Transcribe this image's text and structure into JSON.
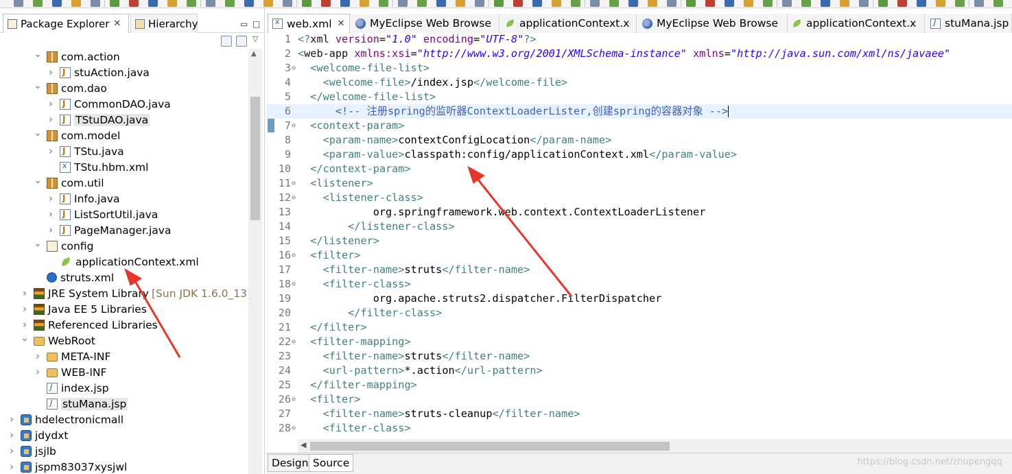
{
  "left_panel": {
    "tabs": [
      {
        "label": "Package Explorer",
        "close": "✕"
      },
      {
        "label": "Hierarchy"
      }
    ],
    "tree": [
      {
        "label": "com.action",
        "icon": "package-icon",
        "indent": 1,
        "expanded": true
      },
      {
        "label": "stuAction.java",
        "icon": "java-file-icon",
        "indent": 2,
        "expanded": false
      },
      {
        "label": "com.dao",
        "icon": "package-icon",
        "indent": 1,
        "expanded": true
      },
      {
        "label": "CommonDAO.java",
        "icon": "java-file-icon",
        "indent": 2,
        "expanded": false
      },
      {
        "label": "TStuDAO.java",
        "icon": "java-file-icon",
        "indent": 2,
        "expanded": false,
        "selected": true
      },
      {
        "label": "com.model",
        "icon": "package-icon",
        "indent": 1,
        "expanded": true
      },
      {
        "label": "TStu.java",
        "icon": "java-file-icon",
        "indent": 2,
        "expanded": false
      },
      {
        "label": "TStu.hbm.xml",
        "icon": "xml-file-icon",
        "indent": 2,
        "leaf": true
      },
      {
        "label": "com.util",
        "icon": "package-icon",
        "indent": 1,
        "expanded": true
      },
      {
        "label": "Info.java",
        "icon": "java-file-icon",
        "indent": 2,
        "expanded": false
      },
      {
        "label": "ListSortUtil.java",
        "icon": "java-file-icon",
        "indent": 2,
        "expanded": false
      },
      {
        "label": "PageManager.java",
        "icon": "java-file-icon",
        "indent": 2,
        "expanded": false
      },
      {
        "label": "config",
        "icon": "source-folder-icon",
        "indent": 1,
        "expanded": true
      },
      {
        "label": "applicationContext.xml",
        "icon": "spring-leaf-icon",
        "indent": 2,
        "leaf": true
      },
      {
        "label": "struts.xml",
        "icon": "gear-icon",
        "indent": 1,
        "leaf": true
      },
      {
        "label": "JRE System Library",
        "extra": "[Sun JDK 1.6.0_13]",
        "icon": "library-icon",
        "indent": 0,
        "expanded": false
      },
      {
        "label": "Java EE 5 Libraries",
        "icon": "library-icon",
        "indent": 0,
        "expanded": false
      },
      {
        "label": "Referenced Libraries",
        "icon": "library-icon",
        "indent": 0,
        "expanded": false
      },
      {
        "label": "WebRoot",
        "icon": "webroot-folder-icon",
        "indent": 0,
        "expanded": true
      },
      {
        "label": "META-INF",
        "icon": "folder-icon",
        "indent": 1,
        "expanded": false
      },
      {
        "label": "WEB-INF",
        "icon": "folder-icon",
        "indent": 1,
        "expanded": false
      },
      {
        "label": "index.jsp",
        "icon": "jsp-file-icon",
        "indent": 1,
        "leaf": true
      },
      {
        "label": "stuMana.jsp",
        "icon": "jsp-file-icon",
        "indent": 1,
        "leaf": true,
        "selected": true
      },
      {
        "label": "hdelectronicmall",
        "icon": "project-icon",
        "indent": -1,
        "expanded": false
      },
      {
        "label": "jdydxt",
        "icon": "project-icon",
        "indent": -1,
        "expanded": false
      },
      {
        "label": "jsjlb",
        "icon": "project-icon",
        "indent": -1,
        "expanded": false
      },
      {
        "label": "jspm83037xysjwl",
        "icon": "project-icon",
        "indent": -1,
        "expanded": false
      }
    ]
  },
  "editor": {
    "tabs": [
      {
        "label": "web.xml",
        "icon": "xml",
        "active": true,
        "close": "✕"
      },
      {
        "label": "MyEclipse Web Browse",
        "icon": "globe"
      },
      {
        "label": "applicationContext.x",
        "icon": "leaf"
      },
      {
        "label": "MyEclipse Web Browse",
        "icon": "globe"
      },
      {
        "label": "applicationContext.x",
        "icon": "leaf"
      },
      {
        "label": "stuMana.jsp",
        "icon": "jsp"
      }
    ],
    "lines": [
      {
        "n": "1",
        "fold": false,
        "hl": false,
        "parts": [
          [
            "pi",
            "<?"
          ],
          [
            "name",
            "xml "
          ],
          [
            "attr",
            "version"
          ],
          [
            "text",
            "="
          ],
          [
            "val",
            "\"1.0\""
          ],
          [
            "text",
            " "
          ],
          [
            "attr",
            "encoding"
          ],
          [
            "text",
            "="
          ],
          [
            "val",
            "\"UTF-8\""
          ],
          [
            "pi",
            "?>"
          ]
        ]
      },
      {
        "n": "2",
        "fold": false,
        "hl": false,
        "parts": [
          [
            "tag",
            "<"
          ],
          [
            "name",
            "web-app "
          ],
          [
            "attr",
            "xmlns:xsi"
          ],
          [
            "text",
            "="
          ],
          [
            "val",
            "\"http://www.w3.org/2001/XMLSchema-instance\""
          ],
          [
            "text",
            " "
          ],
          [
            "attr",
            "xmlns"
          ],
          [
            "text",
            "="
          ],
          [
            "val",
            "\"http://java.sun.com/xml/ns/javaee\""
          ]
        ]
      },
      {
        "n": "3",
        "fold": true,
        "hl": false,
        "parts": [
          [
            "text",
            "  "
          ],
          [
            "tag",
            "<welcome-file-list>"
          ]
        ]
      },
      {
        "n": "4",
        "fold": false,
        "hl": false,
        "parts": [
          [
            "text",
            "    "
          ],
          [
            "tag",
            "<welcome-file>"
          ],
          [
            "text",
            "/index.jsp"
          ],
          [
            "tag",
            "</welcome-file>"
          ]
        ]
      },
      {
        "n": "5",
        "fold": false,
        "hl": false,
        "parts": [
          [
            "text",
            "  "
          ],
          [
            "tag",
            "</welcome-file-list>"
          ]
        ]
      },
      {
        "n": "6",
        "fold": false,
        "hl": true,
        "caret": true,
        "parts": [
          [
            "text",
            "      "
          ],
          [
            "com",
            "<!-- 注册spring的监听器ContextLoaderLister,创建spring的容器对象 -->"
          ]
        ]
      },
      {
        "n": "7",
        "fold": true,
        "hl": false,
        "parts": [
          [
            "text",
            "  "
          ],
          [
            "tag",
            "<context-param>"
          ]
        ]
      },
      {
        "n": "8",
        "fold": false,
        "hl": false,
        "parts": [
          [
            "text",
            "    "
          ],
          [
            "tag",
            "<param-name>"
          ],
          [
            "text",
            "contextConfigLocation"
          ],
          [
            "tag",
            "</param-name>"
          ]
        ]
      },
      {
        "n": "9",
        "fold": false,
        "hl": false,
        "parts": [
          [
            "text",
            "    "
          ],
          [
            "tag",
            "<param-value>"
          ],
          [
            "text",
            "classpath:config/applicationContext.xml"
          ],
          [
            "tag",
            "</param-value>"
          ]
        ]
      },
      {
        "n": "10",
        "fold": false,
        "hl": false,
        "parts": [
          [
            "text",
            "  "
          ],
          [
            "tag",
            "</context-param>"
          ]
        ]
      },
      {
        "n": "11",
        "fold": true,
        "hl": false,
        "parts": [
          [
            "text",
            "  "
          ],
          [
            "tag",
            "<listener>"
          ]
        ]
      },
      {
        "n": "12",
        "fold": true,
        "hl": false,
        "parts": [
          [
            "text",
            "    "
          ],
          [
            "tag",
            "<listener-class>"
          ]
        ]
      },
      {
        "n": "13",
        "fold": false,
        "hl": false,
        "parts": [
          [
            "text",
            "            org.springframework.web.context.ContextLoaderListener"
          ]
        ]
      },
      {
        "n": "14",
        "fold": false,
        "hl": false,
        "parts": [
          [
            "text",
            "        "
          ],
          [
            "tag",
            "</listener-class>"
          ]
        ]
      },
      {
        "n": "15",
        "fold": false,
        "hl": false,
        "parts": [
          [
            "text",
            "  "
          ],
          [
            "tag",
            "</listener>"
          ]
        ]
      },
      {
        "n": "16",
        "fold": true,
        "hl": false,
        "parts": [
          [
            "text",
            "  "
          ],
          [
            "tag",
            "<filter>"
          ]
        ]
      },
      {
        "n": "17",
        "fold": false,
        "hl": false,
        "parts": [
          [
            "text",
            "    "
          ],
          [
            "tag",
            "<filter-name>"
          ],
          [
            "text",
            "struts"
          ],
          [
            "tag",
            "</filter-name>"
          ]
        ]
      },
      {
        "n": "18",
        "fold": true,
        "hl": false,
        "parts": [
          [
            "text",
            "    "
          ],
          [
            "tag",
            "<filter-class>"
          ]
        ]
      },
      {
        "n": "19",
        "fold": false,
        "hl": false,
        "parts": [
          [
            "text",
            "            org.apache.struts2.dispatcher.FilterDispatcher"
          ]
        ]
      },
      {
        "n": "20",
        "fold": false,
        "hl": false,
        "parts": [
          [
            "text",
            "        "
          ],
          [
            "tag",
            "</filter-class>"
          ]
        ]
      },
      {
        "n": "21",
        "fold": false,
        "hl": false,
        "parts": [
          [
            "text",
            "  "
          ],
          [
            "tag",
            "</filter>"
          ]
        ]
      },
      {
        "n": "22",
        "fold": true,
        "hl": false,
        "parts": [
          [
            "text",
            "  "
          ],
          [
            "tag",
            "<filter-mapping>"
          ]
        ]
      },
      {
        "n": "23",
        "fold": false,
        "hl": false,
        "parts": [
          [
            "text",
            "    "
          ],
          [
            "tag",
            "<filter-name>"
          ],
          [
            "text",
            "struts"
          ],
          [
            "tag",
            "</filter-name>"
          ]
        ]
      },
      {
        "n": "24",
        "fold": false,
        "hl": false,
        "parts": [
          [
            "text",
            "    "
          ],
          [
            "tag",
            "<url-pattern>"
          ],
          [
            "text",
            "*.action"
          ],
          [
            "tag",
            "</url-pattern>"
          ]
        ]
      },
      {
        "n": "25",
        "fold": false,
        "hl": false,
        "parts": [
          [
            "text",
            "  "
          ],
          [
            "tag",
            "</filter-mapping>"
          ]
        ]
      },
      {
        "n": "26",
        "fold": true,
        "hl": false,
        "parts": [
          [
            "text",
            "  "
          ],
          [
            "tag",
            "<filter>"
          ]
        ]
      },
      {
        "n": "27",
        "fold": false,
        "hl": false,
        "parts": [
          [
            "text",
            "    "
          ],
          [
            "tag",
            "<filter-name>"
          ],
          [
            "text",
            "struts-cleanup"
          ],
          [
            "tag",
            "</filter-name>"
          ]
        ]
      },
      {
        "n": "28",
        "fold": true,
        "hl": false,
        "parts": [
          [
            "text",
            "    "
          ],
          [
            "tag",
            "<filter-class>"
          ]
        ]
      }
    ],
    "bottom_tabs": [
      {
        "label": "Design",
        "active": false
      },
      {
        "label": "Source",
        "active": true
      }
    ],
    "watermark": "https://blog.csdn.net/zhupengqq"
  },
  "colors": {
    "annotation_arrow": "#e8352a",
    "tag": "#3f7f7f",
    "attribute": "#7f007f",
    "value": "#2a00ff",
    "comment": "#3f5fbf",
    "current_line": "#e8f2fe"
  }
}
